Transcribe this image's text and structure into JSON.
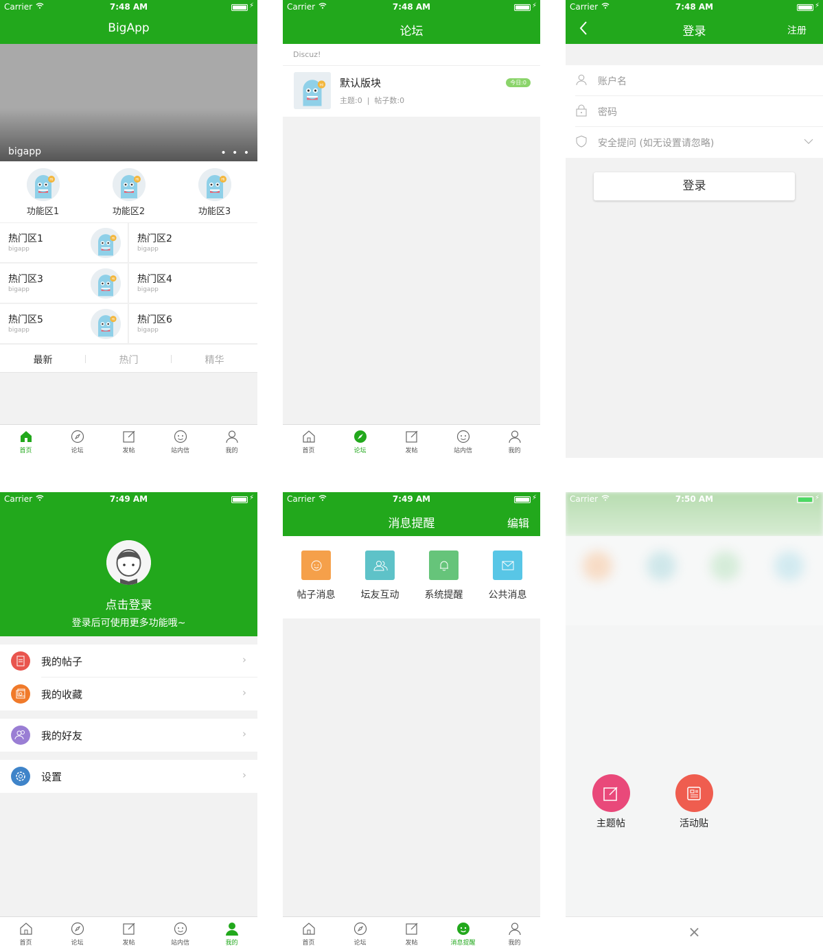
{
  "status": {
    "carrier": "Carrier",
    "time1": "7:48 AM",
    "time2": "7:49 AM",
    "time3": "7:50 AM"
  },
  "colors": {
    "brand": "#22a81c"
  },
  "tabs": [
    "首页",
    "论坛",
    "发帖",
    "站内信",
    "我的"
  ],
  "home": {
    "title": "BigApp",
    "banner_text": "bigapp",
    "more": "• • •",
    "func": [
      "功能区1",
      "功能区2",
      "功能区3"
    ],
    "hot": [
      {
        "t": "热门区1",
        "s": "bigapp"
      },
      {
        "t": "热门区2",
        "s": "bigapp"
      },
      {
        "t": "热门区3",
        "s": "bigapp"
      },
      {
        "t": "热门区4",
        "s": "bigapp"
      },
      {
        "t": "热门区5",
        "s": "bigapp"
      },
      {
        "t": "热门区6",
        "s": "bigapp"
      }
    ],
    "sort": [
      "最新",
      "热门",
      "精华"
    ]
  },
  "forum": {
    "title": "论坛",
    "section": "Discuz!",
    "board_name": "默认版块",
    "board_stats": "主题:0  |  帖子数:0",
    "today": "今日:0"
  },
  "login": {
    "title": "登录",
    "register": "注册",
    "username": "账户名",
    "password": "密码",
    "security": "安全提问 (如无设置请忽略)",
    "button": "登录"
  },
  "me": {
    "login_prompt": "点击登录",
    "login_hint": "登录后可使用更多功能哦~",
    "items": [
      "我的帖子",
      "我的收藏",
      "我的好友",
      "设置"
    ]
  },
  "messages": {
    "title": "消息提醒",
    "edit": "编辑",
    "items": [
      "帖子消息",
      "坛友互动",
      "系统提醒",
      "公共消息"
    ],
    "tab_active": "消息提醒"
  },
  "post": {
    "topic": "主题帖",
    "activity": "活动贴",
    "close": "×"
  }
}
